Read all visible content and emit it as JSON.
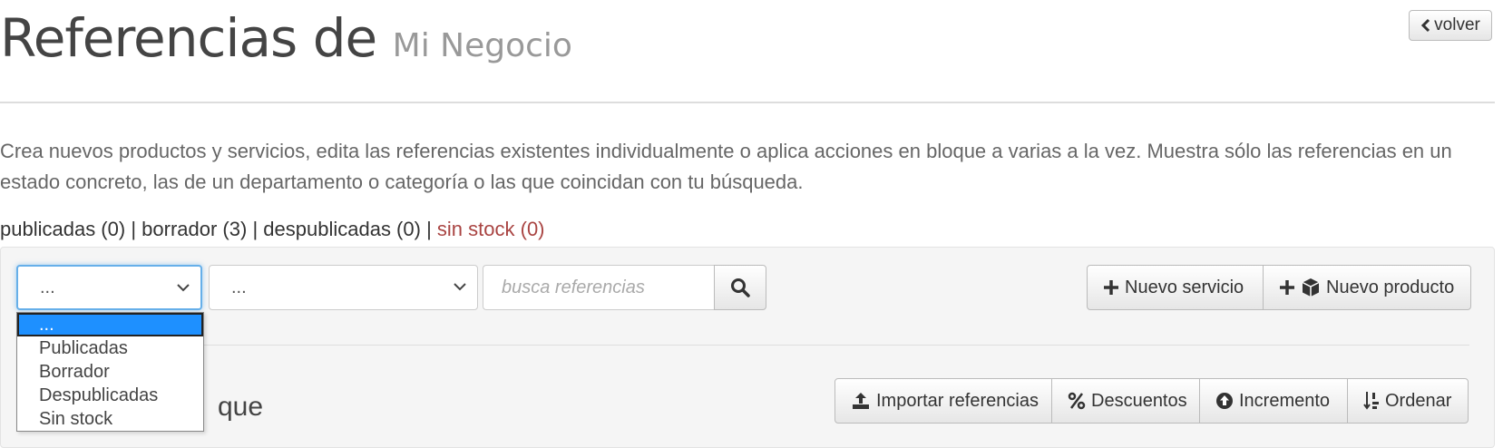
{
  "header": {
    "title": "Referencias de",
    "business_name": "Mi Negocio",
    "back_label": "volver"
  },
  "description": "Crea nuevos productos y servicios, edita las referencias existentes individualmente o aplica acciones en bloque a varias a la vez. Muestra sólo las referencias en un estado concreto, las de un departamento o categoría o las que coincidan con tu búsqueda.",
  "status_filters": {
    "published": "publicadas (0)",
    "draft": "borrador (3)",
    "unpublished": "despublicadas (0)",
    "out_of_stock": "sin stock (0)",
    "separator": "|"
  },
  "toolbar": {
    "status_select_value": "...",
    "category_select_value": "...",
    "search_placeholder": "busca referencias",
    "new_service_label": "Nuevo servicio",
    "new_product_label": "Nuevo producto"
  },
  "status_dropdown": {
    "options": [
      "...",
      "Publicadas",
      "Borrador",
      "Despublicadas",
      "Sin stock"
    ],
    "selected": "..."
  },
  "bulk_actions": {
    "title_visible": "que",
    "import_label": "Importar referencias",
    "discounts_label": "Descuentos",
    "increment_label": "Incremento",
    "sort_label": "Ordenar"
  },
  "colors": {
    "out_of_stock": "#a94442",
    "focus_border": "#66afe9",
    "selected_option": "#1e90ff"
  }
}
